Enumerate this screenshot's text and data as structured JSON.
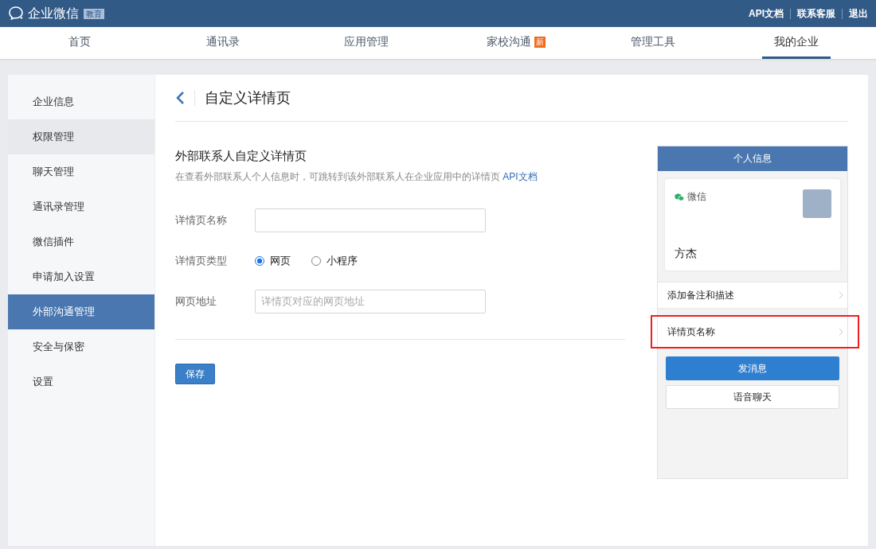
{
  "header": {
    "logo_text": "企业微信",
    "edition_badge": "教育",
    "links": [
      {
        "label": "API文档"
      },
      {
        "label": "联系客服"
      },
      {
        "label": "退出"
      }
    ]
  },
  "tabs": [
    {
      "label": "首页",
      "selected": false
    },
    {
      "label": "通讯录",
      "selected": false
    },
    {
      "label": "应用管理",
      "selected": false
    },
    {
      "label": "家校沟通",
      "selected": false,
      "badge": "新"
    },
    {
      "label": "管理工具",
      "selected": false
    },
    {
      "label": "我的企业",
      "selected": true
    }
  ],
  "sidebar": {
    "items": [
      {
        "label": "企业信息",
        "selected": false,
        "hovered": false
      },
      {
        "label": "权限管理",
        "selected": false,
        "hovered": true
      },
      {
        "label": "聊天管理",
        "selected": false,
        "hovered": false
      },
      {
        "label": "通讯录管理",
        "selected": false,
        "hovered": false
      },
      {
        "label": "微信插件",
        "selected": false,
        "hovered": false
      },
      {
        "label": "申请加入设置",
        "selected": false,
        "hovered": false
      },
      {
        "label": "外部沟通管理",
        "selected": true,
        "hovered": false
      },
      {
        "label": "安全与保密",
        "selected": false,
        "hovered": false
      },
      {
        "label": "设置",
        "selected": false,
        "hovered": false
      }
    ]
  },
  "page": {
    "title": "自定义详情页",
    "section_title": "外部联系人自定义详情页",
    "description": "在查看外部联系人个人信息时，可跳转到该外部联系人在企业应用中的详情页",
    "description_link": "API文档",
    "form": [
      {
        "kind": "text",
        "label": "详情页名称"
      },
      {
        "kind": "radio",
        "label": "详情页类型",
        "options": [
          {
            "label": "网页",
            "selected": true
          },
          {
            "label": "小程序",
            "selected": false
          }
        ]
      },
      {
        "kind": "text",
        "label": "网页地址",
        "placeholder": "详情页对应的网页地址"
      }
    ],
    "save_button": "保存"
  },
  "preview": {
    "title": "个人信息",
    "source": "微信",
    "name": "方杰",
    "rows": [
      {
        "label": "添加备注和描述",
        "highlighted": false
      },
      {
        "label": "详情页名称",
        "highlighted": true
      }
    ],
    "buttons": [
      {
        "label": "发消息",
        "kind": "primary"
      },
      {
        "label": "语音聊天",
        "kind": "default"
      }
    ]
  }
}
